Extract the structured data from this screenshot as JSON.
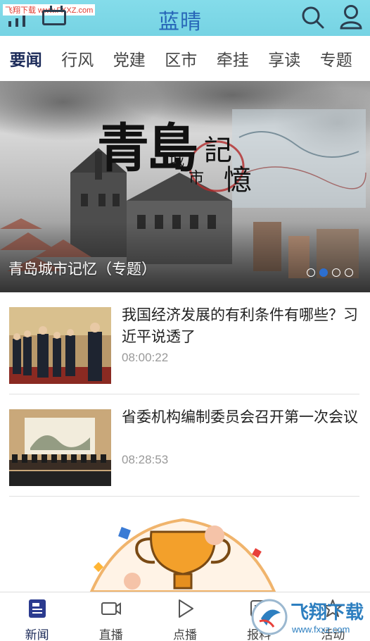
{
  "watermark_top": "飞翔下载 www.FXXZ.com",
  "header": {
    "logo": "蓝晴"
  },
  "tabs": [
    {
      "label": "要闻",
      "active": true
    },
    {
      "label": "行风",
      "active": false
    },
    {
      "label": "党建",
      "active": false
    },
    {
      "label": "区市",
      "active": false
    },
    {
      "label": "牵挂",
      "active": false
    },
    {
      "label": "享读",
      "active": false
    },
    {
      "label": "专题",
      "active": false
    }
  ],
  "banner": {
    "art_title_big": "青島",
    "art_title_small": [
      "城",
      "市",
      "記",
      "憶"
    ],
    "caption": "青岛城市记忆（专题）",
    "dots_total": 4,
    "dot_active": 2
  },
  "news": [
    {
      "title": "我国经济发展的有利条件有哪些？习近平说透了",
      "time": "08:00:22"
    },
    {
      "title": "省委机构编制委员会召开第一次会议",
      "time": "08:28:53"
    }
  ],
  "bottom_nav": [
    {
      "label": "新闻",
      "icon": "news-icon",
      "active": true
    },
    {
      "label": "直播",
      "icon": "video-camera-icon",
      "active": false
    },
    {
      "label": "点播",
      "icon": "play-icon",
      "active": false
    },
    {
      "label": "报料",
      "icon": "report-icon",
      "active": false
    },
    {
      "label": "活动",
      "icon": "activity-icon",
      "active": false
    }
  ],
  "watermark_bottom": {
    "brand": "飞翔下载",
    "url": "www.fxxz.com"
  },
  "colors": {
    "header_bg": "#7ed8e7",
    "logo": "#2766b8",
    "active_tab": "#1c2b59",
    "dot_active": "#2d6fd0"
  }
}
